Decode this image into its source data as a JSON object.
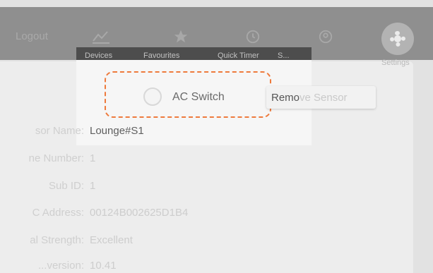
{
  "nav": {
    "title": "Logout",
    "items": [
      {
        "icon": "chart-icon",
        "label": "Devices"
      },
      {
        "icon": "star-icon",
        "label": "Favourites"
      },
      {
        "icon": "clock-icon",
        "label": "Quick Timer"
      },
      {
        "icon": "user-icon",
        "label": "S..."
      },
      {
        "icon": "gear-icon",
        "label": "Settings"
      }
    ]
  },
  "modal": {
    "toggle_label": "AC Switch",
    "remove_button": {
      "prefix": "Remo",
      "suffix": "ve Sensor"
    },
    "rows": [
      {
        "label": "sor Name:",
        "value": "Lounge#S1"
      },
      {
        "label": "ne Number:",
        "value": "1"
      },
      {
        "label": "Sub ID:",
        "value": "1"
      },
      {
        "label": "C Address:",
        "value": "00124B002625D1B4"
      },
      {
        "label": "al Strength:",
        "value": "Excellent"
      },
      {
        "label": "...version:",
        "value": "10.41"
      }
    ]
  },
  "colors": {
    "highlight": "#ee7a3c",
    "overlay": "#8f8f8f"
  }
}
